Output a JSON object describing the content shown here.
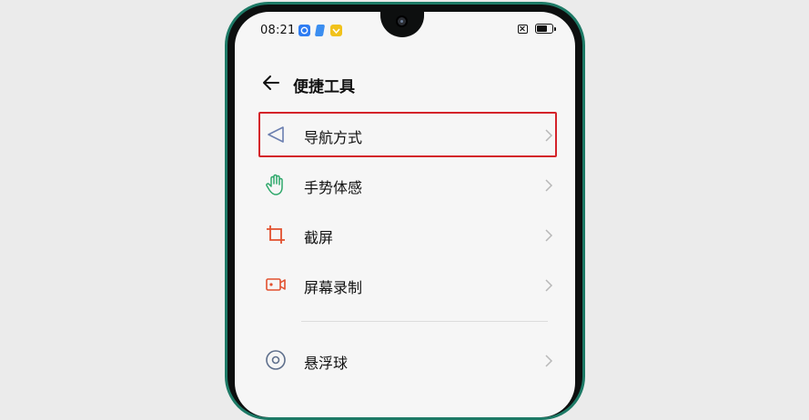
{
  "status_bar": {
    "time": "08:21",
    "icons": [
      "app-notification-icon",
      "app-notification-icon-2",
      "app-notification-icon-3",
      "sim-icon",
      "battery-icon"
    ],
    "battery_level": 0.7
  },
  "header": {
    "title": "便捷工具",
    "back_icon": "arrow-left-icon"
  },
  "items": [
    {
      "label": "导航方式",
      "icon": "navigation-triangle-icon",
      "icon_color": "#6b7fb0"
    },
    {
      "label": "手势体感",
      "icon": "hand-gesture-icon",
      "icon_color": "#2fa86b"
    },
    {
      "label": "截屏",
      "icon": "crop-icon",
      "icon_color": "#e2502e"
    },
    {
      "label": "屏幕录制",
      "icon": "screen-record-icon",
      "icon_color": "#e2502e"
    },
    {
      "label": "悬浮球",
      "icon": "floating-ball-icon",
      "icon_color": "#5e6f8c"
    }
  ],
  "highlight_color": "#d4232a",
  "frame_color": "#1d7a66"
}
